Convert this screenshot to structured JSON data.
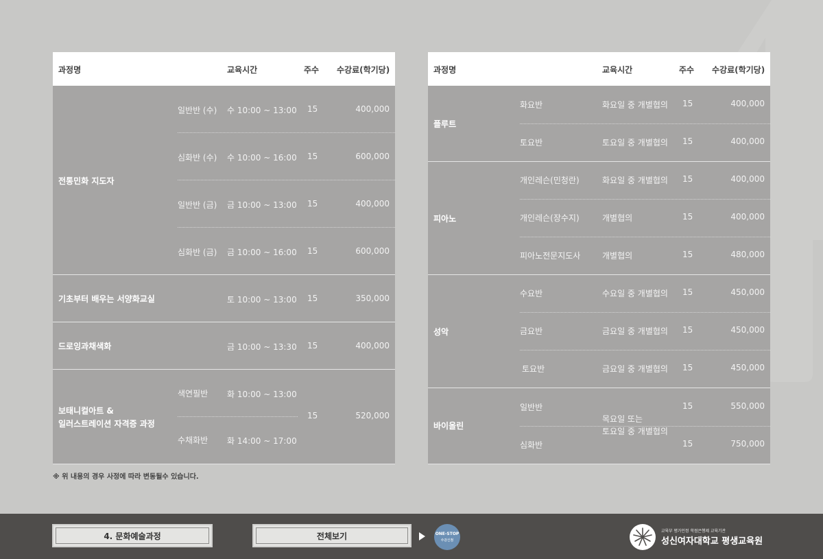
{
  "left_table": {
    "headers": [
      "과정명",
      "교육시간",
      "주수",
      "수강료(학기당)"
    ],
    "courses": [
      {
        "name": "전통민화 지도자",
        "rows": [
          {
            "class": "일반반 (수)",
            "time": "수 10:00 ~ 13:00",
            "weeks": "15",
            "fee": "400,000"
          },
          {
            "class": "심화반 (수)",
            "time": "수 10:00 ~ 16:00",
            "weeks": "15",
            "fee": "600,000"
          },
          {
            "class": "일반반 (금)",
            "time": "금 10:00 ~ 13:00",
            "weeks": "15",
            "fee": "400,000"
          },
          {
            "class": "심화반 (금)",
            "time": "금 10:00 ~ 16:00",
            "weeks": "15",
            "fee": "600,000"
          }
        ]
      },
      {
        "name": "기초부터 배우는 서양화교실",
        "rows": [
          {
            "class": "",
            "time": "토 10:00 ~ 13:00",
            "weeks": "15",
            "fee": "350,000"
          }
        ]
      },
      {
        "name": "드로잉과채색화",
        "rows": [
          {
            "class": "",
            "time": "금 10:00 ~ 13:30",
            "weeks": "15",
            "fee": "400,000"
          }
        ]
      },
      {
        "name_line1": "보태니컬아트 &",
        "name_line2": "일러스트레이션 자격증 과정",
        "rows": [
          {
            "class": "색연필반",
            "time": "화 10:00 ~ 13:00"
          },
          {
            "class": "수채화반",
            "time": "화 14:00 ~ 17:00"
          }
        ],
        "weeks": "15",
        "fee": "520,000"
      }
    ]
  },
  "right_table": {
    "headers": [
      "과정명",
      "교육시간",
      "주수",
      "수강료(학기당)"
    ],
    "courses": [
      {
        "name": "플루트",
        "rows": [
          {
            "class": "화요반",
            "time": "화요일 중 개별협의",
            "weeks": "15",
            "fee": "400,000"
          },
          {
            "class": "토요반",
            "time": "토요일 중 개별협의",
            "weeks": "15",
            "fee": "400,000"
          }
        ]
      },
      {
        "name": "피아노",
        "rows": [
          {
            "class": "개인레슨(민청란)",
            "time": "화요일 중 개별협의",
            "weeks": "15",
            "fee": "400,000"
          },
          {
            "class": "개인레슨(장수지)",
            "time": "개별협의",
            "weeks": "15",
            "fee": "400,000"
          },
          {
            "class": "피아노전문지도사",
            "time": "개별협의",
            "weeks": "15",
            "fee": "480,000"
          }
        ]
      },
      {
        "name": "성악",
        "rows": [
          {
            "class": "수요반",
            "time": "수요일 중 개별협의",
            "weeks": "15",
            "fee": "450,000"
          },
          {
            "class": "금요반",
            "time": "금요일 중 개별협의",
            "weeks": "15",
            "fee": "450,000"
          },
          {
            "class": "토요반",
            "time": "금요일 중 개별협의",
            "weeks": "15",
            "fee": "450,000"
          }
        ]
      },
      {
        "name": "바이올린",
        "time_line1": "목요일 또는",
        "time_line2": "토요일 중 개별협의",
        "rows": [
          {
            "class": "일반반",
            "weeks": "15",
            "fee": "550,000"
          },
          {
            "class": "심화반",
            "weeks": "15",
            "fee": "750,000"
          }
        ]
      }
    ]
  },
  "note": "※ 위 내용의 경우 사정에 따라 변동될수 있습니다.",
  "footer": {
    "category_button": "4. 문화예술과정",
    "view_all_button": "전체보기",
    "onestop_line1": "ONE-STOP",
    "onestop_line2": "수강신청",
    "logo_tagline": "교육부 평가인정 학점은행제 교육기관",
    "logo_name": "성신여자대학교 평생교육원"
  },
  "decor_number": "4",
  "colors": {
    "background": "#c8c8c6",
    "table_body": "#a6a5a4",
    "footer": "#4f4d4b",
    "onestop": "#6b8fb4"
  }
}
